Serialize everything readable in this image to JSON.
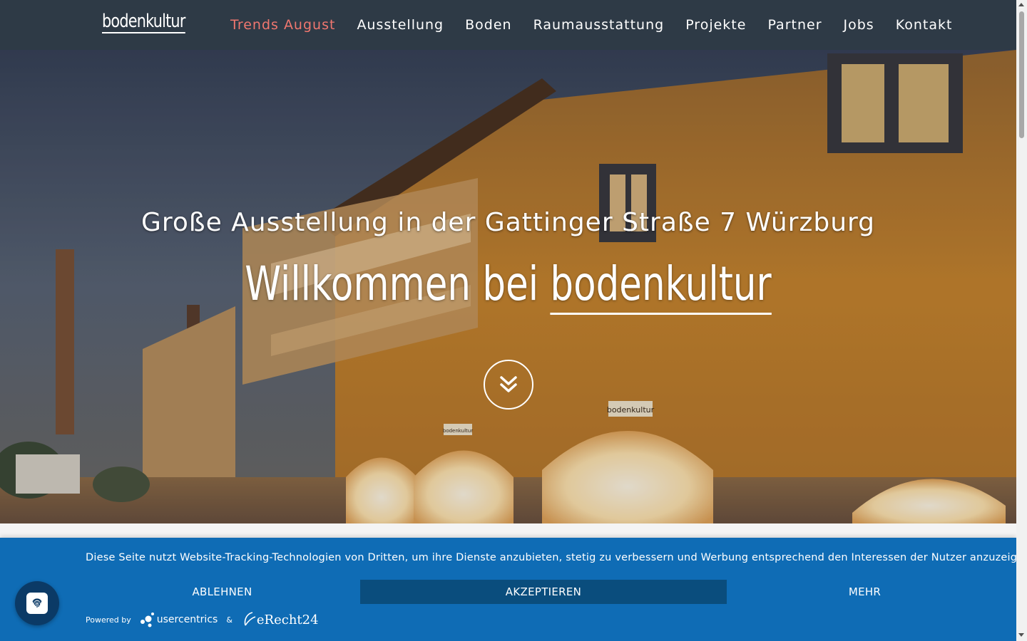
{
  "header": {
    "logo": "bodenkultur",
    "nav": [
      {
        "label": "Trends August",
        "active": true
      },
      {
        "label": "Ausstellung"
      },
      {
        "label": "Boden"
      },
      {
        "label": "Raumausstattung"
      },
      {
        "label": "Projekte"
      },
      {
        "label": "Partner"
      },
      {
        "label": "Jobs"
      },
      {
        "label": "Kontakt"
      }
    ]
  },
  "hero": {
    "subtitle": "Große Ausstellung in der Gattinger Straße 7 Würzburg",
    "title_prefix": "Willkommen bei ",
    "title_brand": "bodenkultur",
    "scroll_icon": "double-chevron-down-icon",
    "signage": [
      "bodenkultur",
      "bodenkultur"
    ]
  },
  "cookie_banner": {
    "text": "Diese Seite nutzt Website-Tracking-Technologien von Dritten, um ihre Dienste anzubieten, stetig zu verbessern und Werbung entsprechend den Interessen der Nutzer anzuzeigen.",
    "decline_label": "ABLEHNEN",
    "accept_label": "AKZEPTIEREN",
    "more_label": "MEHR",
    "powered_by": "Powered by",
    "usercentrics": "usercentrics",
    "ampersand": "&",
    "erecht": "eRecht24"
  },
  "colors": {
    "header_bg": "#2e3a46",
    "nav_active": "#f0776f",
    "banner_bg": "#0f6cb5",
    "accept_bg": "#0a4d7d",
    "chat_bg": "#0b3a66"
  },
  "chat": {
    "icon": "fingerprint-icon"
  }
}
